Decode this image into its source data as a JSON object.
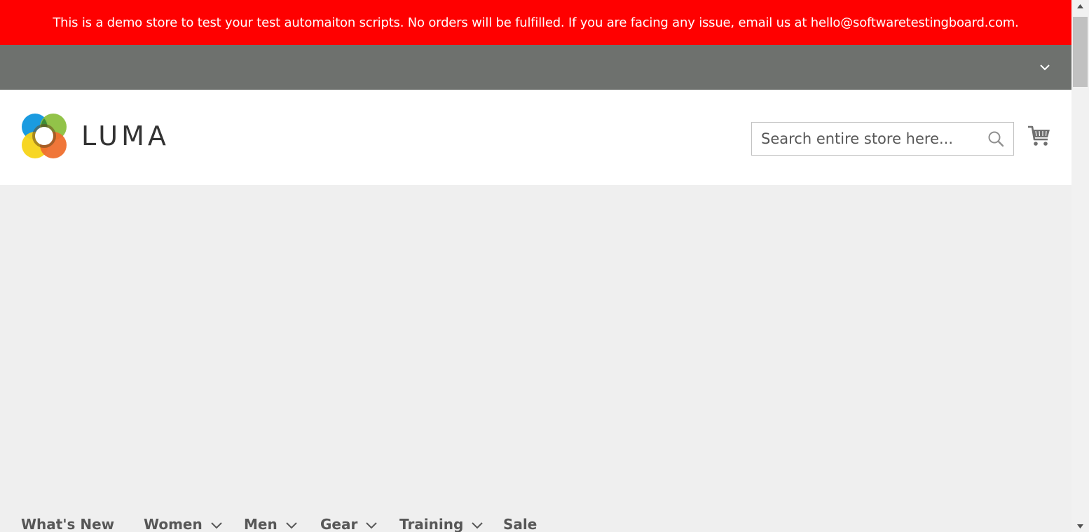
{
  "banner": {
    "text": "This is a demo store to test your test automaiton scripts. No orders will be fulfilled. If you are facing any issue, email us at hello@softwaretestingboard.com.",
    "color": "#ff0000"
  },
  "panel": {
    "toggle_icon": "chevron-down-icon",
    "color": "#6e716e"
  },
  "header": {
    "logo_text": "LUMA",
    "search": {
      "placeholder": "Search entire store here...",
      "value": "",
      "icon": "search-icon"
    },
    "cart_icon": "shopping-cart-icon"
  },
  "nav": {
    "items": [
      {
        "label": "What's New",
        "has_dropdown": false
      },
      {
        "label": "Women",
        "has_dropdown": true
      },
      {
        "label": "Men",
        "has_dropdown": true
      },
      {
        "label": "Gear",
        "has_dropdown": true
      },
      {
        "label": "Training",
        "has_dropdown": true
      },
      {
        "label": "Sale",
        "has_dropdown": false
      }
    ]
  },
  "colors": {
    "page_background": "#efefef",
    "nav_text": "#575757"
  }
}
